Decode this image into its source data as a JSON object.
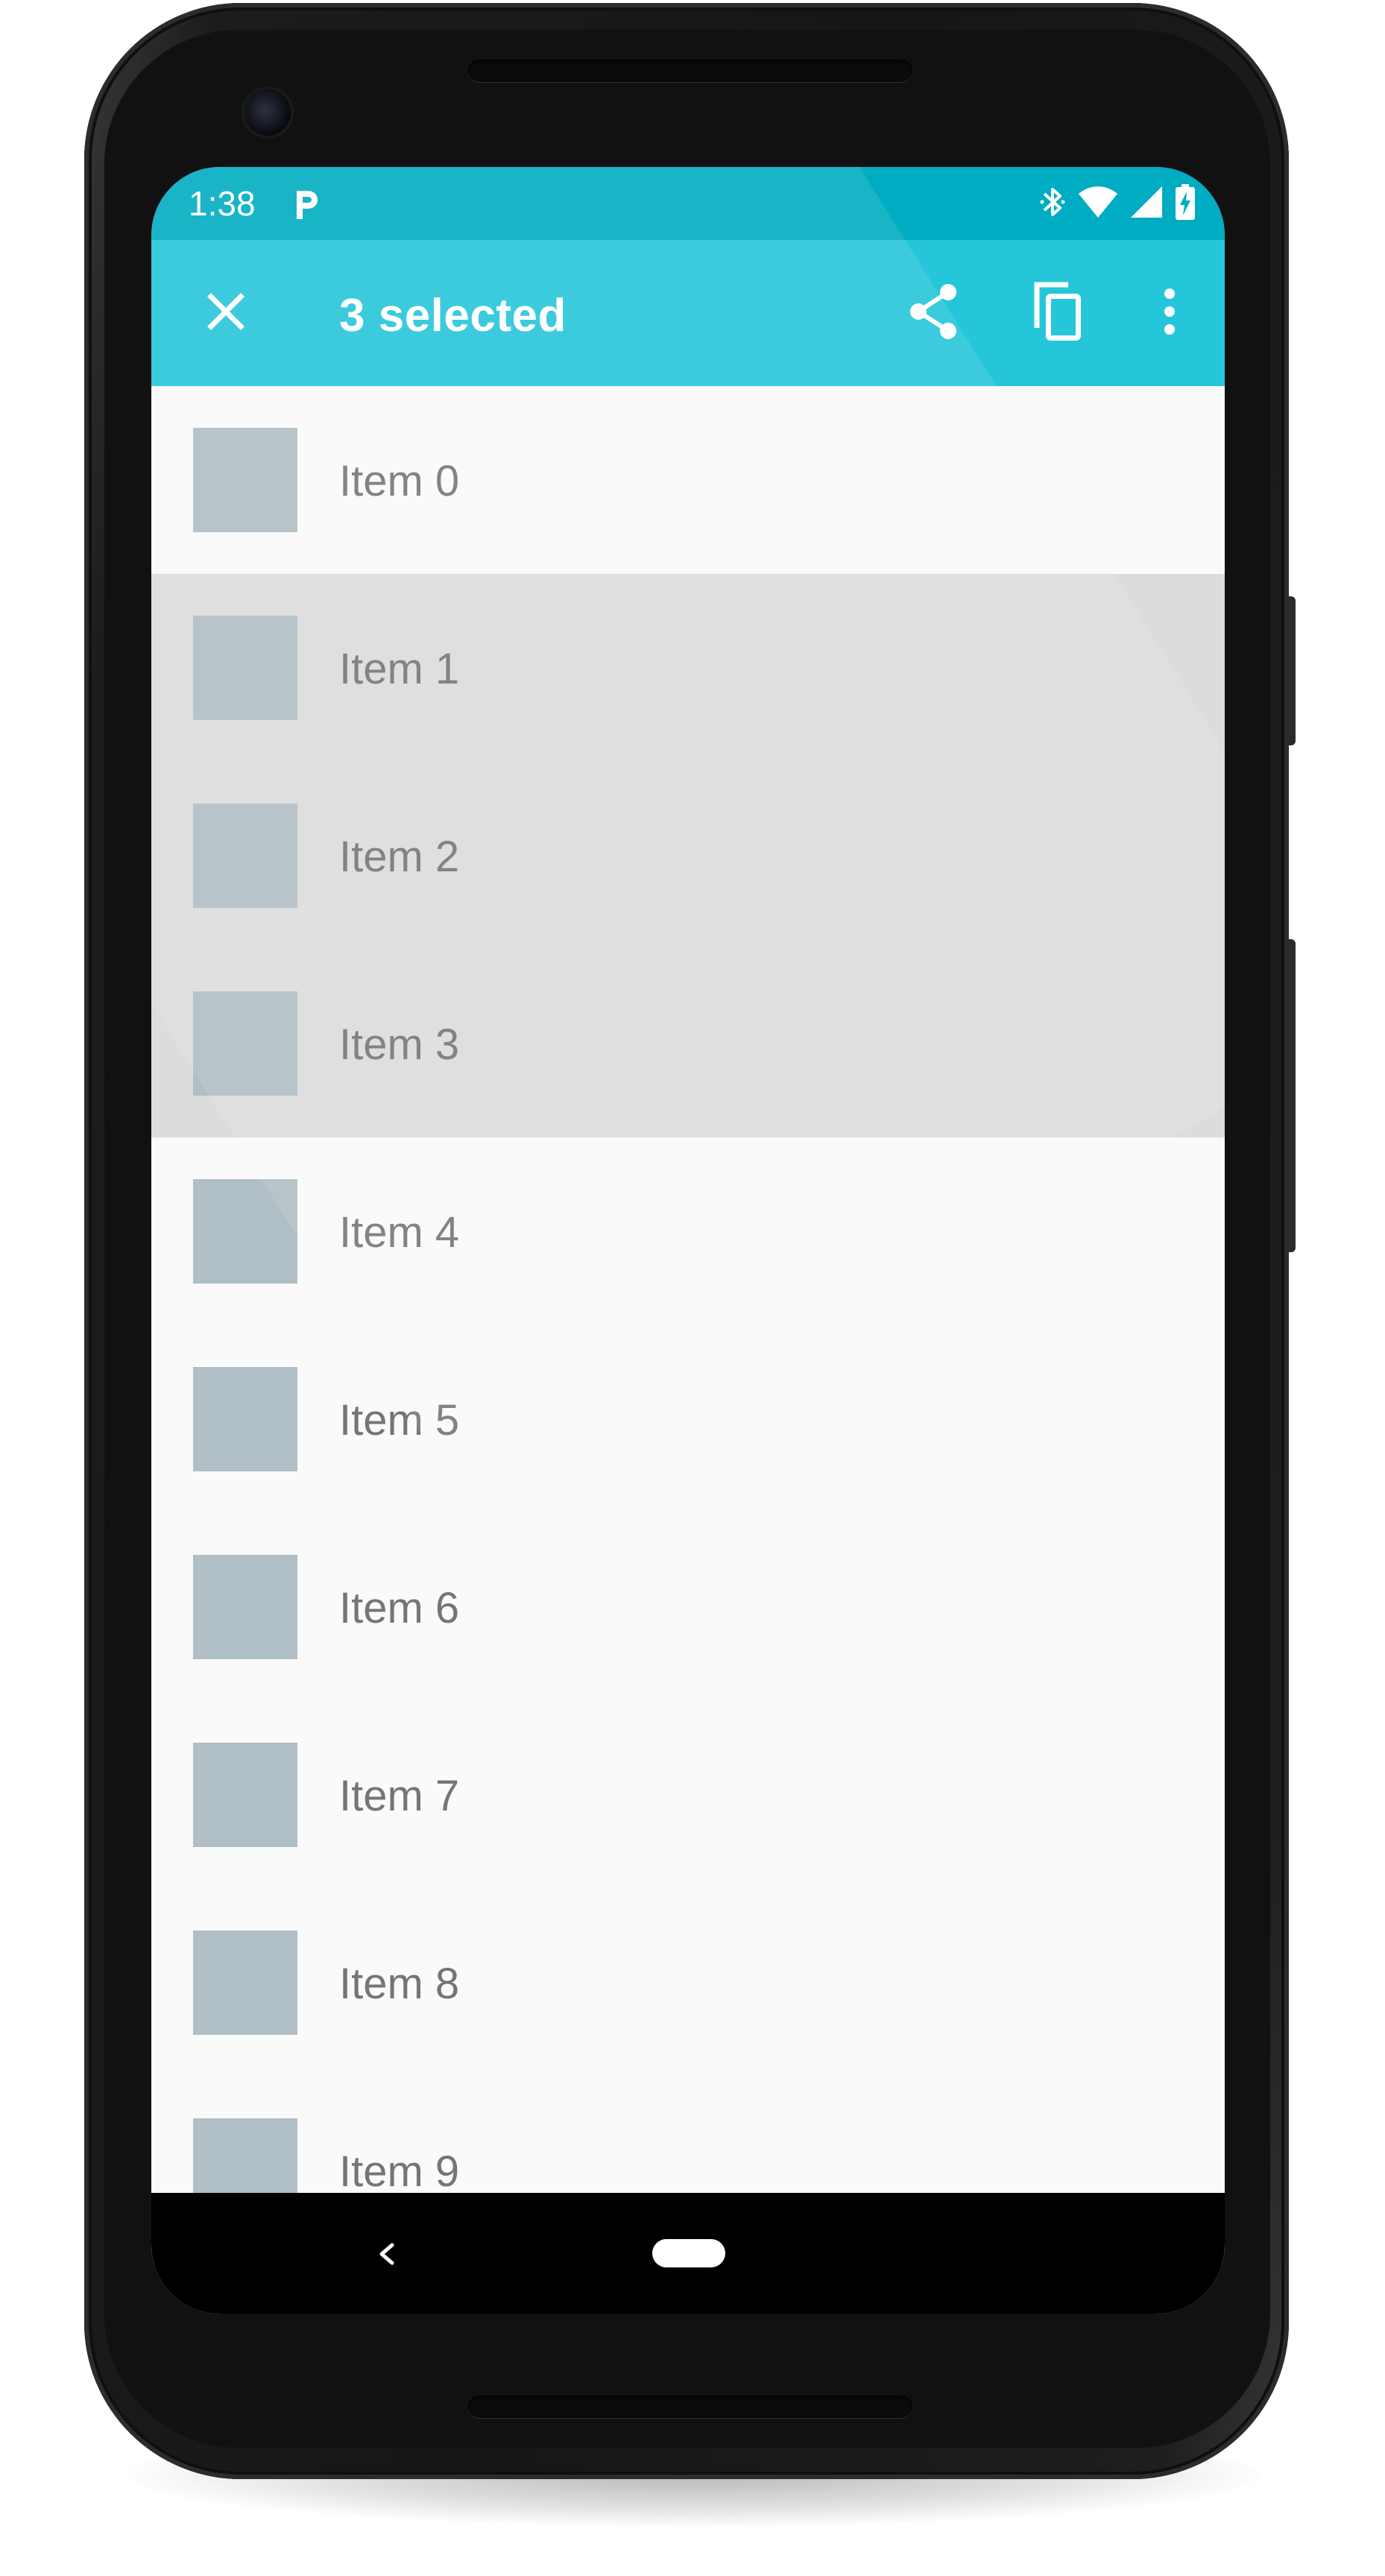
{
  "status_bar": {
    "time": "1:38",
    "notification_icon": "parking-p-icon",
    "icons": [
      "bluetooth-icon",
      "wifi-icon",
      "cell-signal-icon",
      "battery-charging-icon"
    ],
    "background_color": "#00acc1"
  },
  "action_bar": {
    "title": "3 selected",
    "close_icon": "close-icon",
    "share_icon": "share-icon",
    "copy_icon": "copy-icon",
    "more_icon": "more-vert-icon",
    "background_color": "#26c6da"
  },
  "list": {
    "items": [
      {
        "label": "Item 0",
        "selected": false
      },
      {
        "label": "Item 1",
        "selected": true
      },
      {
        "label": "Item 2",
        "selected": true
      },
      {
        "label": "Item 3",
        "selected": true
      },
      {
        "label": "Item 4",
        "selected": false
      },
      {
        "label": "Item 5",
        "selected": false
      },
      {
        "label": "Item 6",
        "selected": false
      },
      {
        "label": "Item 7",
        "selected": false
      },
      {
        "label": "Item 8",
        "selected": false
      },
      {
        "label": "Item 9",
        "selected": false
      }
    ],
    "selected_color": "#dcdcdc",
    "thumbnail_color": "#b0bec5"
  },
  "nav_bar": {
    "back_icon": "back-chevron-icon",
    "home_icon": "home-pill-icon"
  }
}
